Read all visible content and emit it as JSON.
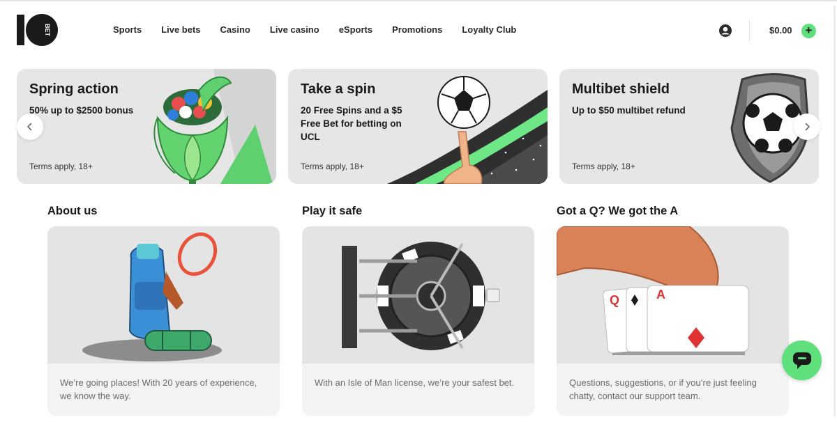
{
  "brand": {
    "logo_text": "BET",
    "accent_color": "#5fe07d"
  },
  "nav": {
    "items": [
      {
        "label": "Sports"
      },
      {
        "label": "Live bets"
      },
      {
        "label": "Casino"
      },
      {
        "label": "Live casino"
      },
      {
        "label": "eSports"
      },
      {
        "label": "Promotions"
      },
      {
        "label": "Loyalty Club"
      }
    ]
  },
  "header": {
    "balance": "$0.00",
    "user_icon": "user-circle-icon",
    "deposit_icon": "plus-icon"
  },
  "promos": [
    {
      "title": "Spring action",
      "subtitle": "50% up to $2500 bonus",
      "terms": "Terms apply, 18+"
    },
    {
      "title": "Take a spin",
      "subtitle": "20 Free Spins and a $5 Free Bet for betting on UCL",
      "terms": "Terms apply, 18+"
    },
    {
      "title": "Multibet shield",
      "subtitle": "Up to $50 multibet refund",
      "terms": "Terms apply, 18+"
    }
  ],
  "carousel": {
    "prev_icon": "chevron-left-icon",
    "next_icon": "chevron-right-icon"
  },
  "info": [
    {
      "heading": "About us",
      "text": "We’re going places! With 20 years of experience, we know the way."
    },
    {
      "heading": "Play it safe",
      "text": "With an Isle of Man license, we’re your safest bet."
    },
    {
      "heading": "Got a Q? We got the A",
      "text": "Questions, suggestions, or if you’re just feeling chatty, contact our support team."
    }
  ],
  "card_labels": {
    "queen": "Q",
    "ace": "A"
  },
  "chat": {
    "icon": "chat-bubble-icon"
  }
}
